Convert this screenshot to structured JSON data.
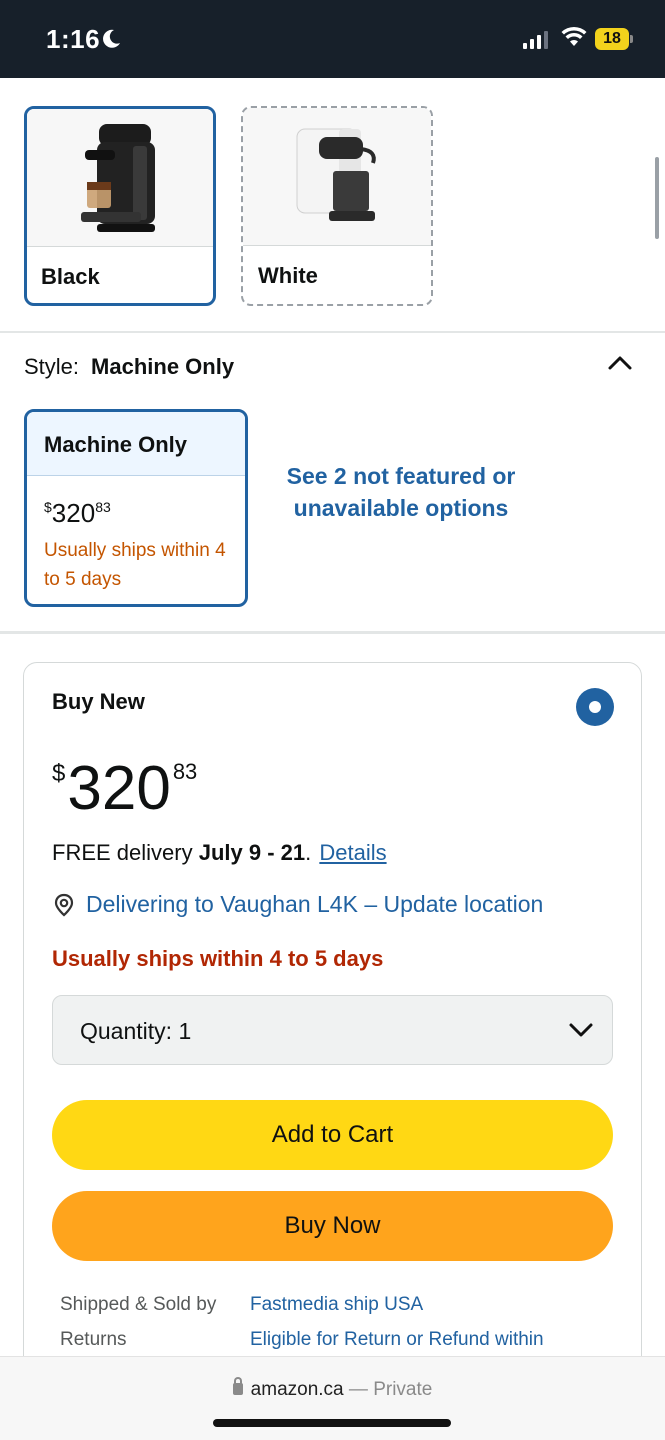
{
  "status": {
    "time": "1:16",
    "battery": "18"
  },
  "colors": [
    {
      "label": "Black",
      "selected": true
    },
    {
      "label": "White",
      "selected": false
    }
  ],
  "style": {
    "key": "Style:",
    "value": "Machine Only",
    "option": {
      "name": "Machine Only",
      "price_currency": "$",
      "price_whole": "320",
      "price_cents": "83",
      "ships": "Usually ships within 4 to 5 days"
    },
    "see_more": "See 2 not featured or unavailable options"
  },
  "buy": {
    "title": "Buy New",
    "price_currency": "$",
    "price_whole": "320",
    "price_cents": "83",
    "delivery_prefix": "FREE delivery ",
    "delivery_dates": "July 9 - 21",
    "delivery_sep": ". ",
    "details_link": "Details",
    "location": "Delivering to Vaughan L4K – Update location",
    "ships": "Usually ships within 4 to 5 days",
    "quantity_label": "Quantity:",
    "quantity_value": "1",
    "add_to_cart": "Add to Cart",
    "buy_now": "Buy Now",
    "info": [
      {
        "key": "Shipped & Sold by",
        "value": "Fastmedia ship USA"
      },
      {
        "key": "Returns",
        "value": "Eligible for Return or Refund within"
      }
    ]
  },
  "browser": {
    "domain": "amazon.ca",
    "separator": " — ",
    "mode": "Private"
  },
  "theme": {
    "link": "#2162a1",
    "cart": "#ffd814",
    "buy": "#ffa41c",
    "ships_orange": "#c45500",
    "ships_red": "#b12704"
  }
}
